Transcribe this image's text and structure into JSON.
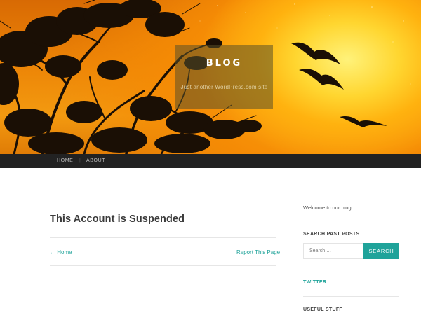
{
  "header": {
    "title": "BLOG",
    "tagline": "Just another WordPress.com site"
  },
  "nav": {
    "items": [
      {
        "label": "HOME"
      },
      {
        "label": "ABOUT"
      }
    ]
  },
  "main": {
    "post_title": "This Account is Suspended",
    "prev_link": "← Home",
    "report_link": "Report This Page"
  },
  "sidebar": {
    "welcome_text": "Welcome to our blog.",
    "search_heading": "SEARCH PAST POSTS",
    "search_placeholder": "Search …",
    "search_button": "SEARCH",
    "twitter_heading": "TWITTER",
    "useful_heading": "USEFUL STUFF"
  },
  "colors": {
    "accent": "#1fa39a",
    "navbar": "#222222",
    "sky_orange": "#f08a06",
    "sun_yellow": "#ffe34a"
  },
  "icons": {
    "header_image": "sunset-trees-birds-image"
  }
}
